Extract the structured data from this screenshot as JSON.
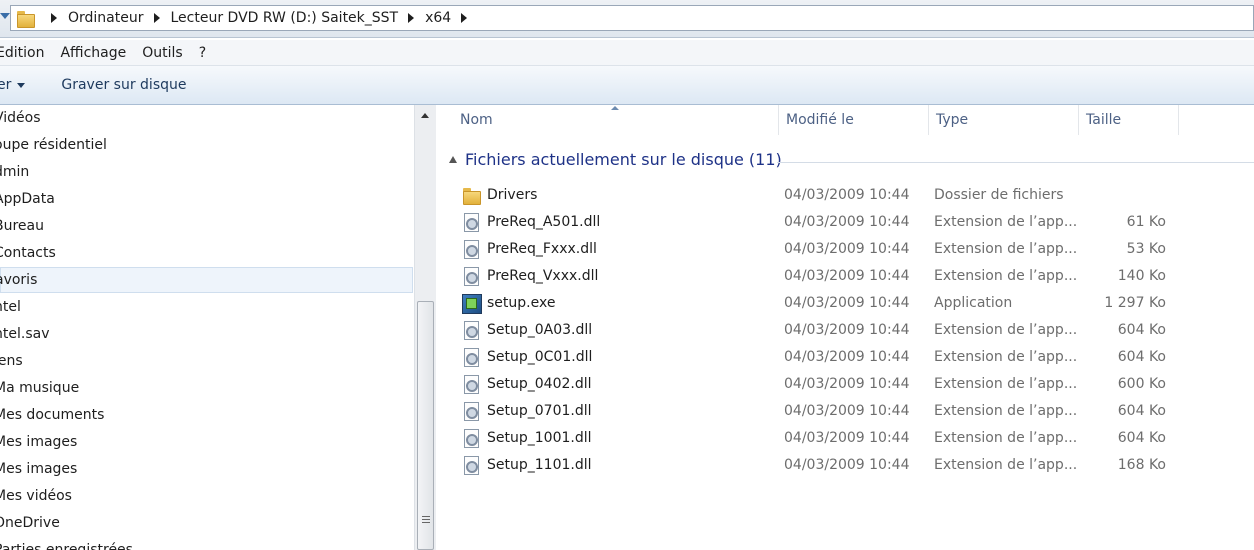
{
  "address": {
    "crumbs": [
      "Ordinateur",
      "Lecteur DVD RW (D:) Saitek_SST",
      "x64"
    ]
  },
  "menu": [
    "Edition",
    "Affichage",
    "Outils",
    "?"
  ],
  "commands": {
    "organize_label": "er",
    "burn_label": "Graver sur disque"
  },
  "nav": {
    "items": [
      "Vidéos",
      "oupe résidentiel",
      "dmin",
      "AppData",
      "Bureau",
      "Contacts",
      "avoris",
      "ntel",
      "ntel.sav",
      "iens",
      "Ma musique",
      "Mes documents",
      "Mes images",
      "Mes images",
      "Mes vidéos",
      "OneDrive",
      "Parties enregistrées"
    ],
    "selected_index": 6
  },
  "columns": {
    "name": "Nom",
    "date": "Modifié le",
    "type": "Type",
    "size": "Taille"
  },
  "group": {
    "title": "Fichiers actuellement sur le disque (11)"
  },
  "files": [
    {
      "name": "Drivers",
      "date": "04/03/2009 10:44",
      "type": "Dossier de fichiers",
      "size": "",
      "icon": "folder-icon"
    },
    {
      "name": "PreReq_A501.dll",
      "date": "04/03/2009 10:44",
      "type": "Extension de l’app...",
      "size": "61 Ko",
      "icon": "dll-file-icon"
    },
    {
      "name": "PreReq_Fxxx.dll",
      "date": "04/03/2009 10:44",
      "type": "Extension de l’app...",
      "size": "53 Ko",
      "icon": "dll-file-icon"
    },
    {
      "name": "PreReq_Vxxx.dll",
      "date": "04/03/2009 10:44",
      "type": "Extension de l’app...",
      "size": "140 Ko",
      "icon": "dll-file-icon"
    },
    {
      "name": "setup.exe",
      "date": "04/03/2009 10:44",
      "type": "Application",
      "size": "1 297 Ko",
      "icon": "setup-exe-icon"
    },
    {
      "name": "Setup_0A03.dll",
      "date": "04/03/2009 10:44",
      "type": "Extension de l’app...",
      "size": "604 Ko",
      "icon": "dll-file-icon"
    },
    {
      "name": "Setup_0C01.dll",
      "date": "04/03/2009 10:44",
      "type": "Extension de l’app...",
      "size": "604 Ko",
      "icon": "dll-file-icon"
    },
    {
      "name": "Setup_0402.dll",
      "date": "04/03/2009 10:44",
      "type": "Extension de l’app...",
      "size": "600 Ko",
      "icon": "dll-file-icon"
    },
    {
      "name": "Setup_0701.dll",
      "date": "04/03/2009 10:44",
      "type": "Extension de l’app...",
      "size": "604 Ko",
      "icon": "dll-file-icon"
    },
    {
      "name": "Setup_1001.dll",
      "date": "04/03/2009 10:44",
      "type": "Extension de l’app...",
      "size": "604 Ko",
      "icon": "dll-file-icon"
    },
    {
      "name": "Setup_1101.dll",
      "date": "04/03/2009 10:44",
      "type": "Extension de l’app...",
      "size": "168 Ko",
      "icon": "dll-file-icon"
    }
  ]
}
